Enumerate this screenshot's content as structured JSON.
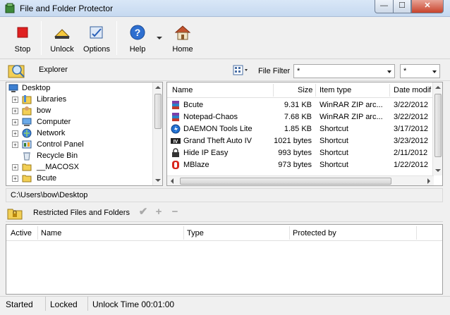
{
  "window": {
    "title": "File and Folder Protector",
    "min_glyph": "—",
    "max_glyph": "☐",
    "close_glyph": "✕"
  },
  "toolbar": {
    "stop": "Stop",
    "unlock": "Unlock",
    "options": "Options",
    "help": "Help",
    "home": "Home"
  },
  "explorer": {
    "label": "Explorer",
    "file_filter_label": "File Filter",
    "filter_value_1": "*",
    "filter_value_2": "*"
  },
  "tree": {
    "items": [
      {
        "label": "Desktop",
        "icon": "desktop-icon"
      },
      {
        "label": "Libraries",
        "icon": "libraries-icon"
      },
      {
        "label": "bow",
        "icon": "user-folder-icon"
      },
      {
        "label": "Computer",
        "icon": "computer-icon"
      },
      {
        "label": "Network",
        "icon": "network-icon"
      },
      {
        "label": "Control Panel",
        "icon": "control-panel-icon"
      },
      {
        "label": "Recycle Bin",
        "icon": "recycle-bin-icon"
      },
      {
        "label": "__MACOSX",
        "icon": "folder-icon"
      },
      {
        "label": "Bcute",
        "icon": "folder-icon"
      }
    ]
  },
  "files": {
    "headers": [
      "Name",
      "Size",
      "Item type",
      "Date modif"
    ],
    "rows": [
      {
        "name": "Bcute",
        "size": "9.31 KB",
        "type": "WinRAR ZIP arc...",
        "date": "3/22/2012",
        "icon": "winrar-icon"
      },
      {
        "name": "Notepad-Chaos",
        "size": "7.68 KB",
        "type": "WinRAR ZIP arc...",
        "date": "3/22/2012",
        "icon": "winrar-icon"
      },
      {
        "name": "DAEMON Tools Lite",
        "size": "1.85 KB",
        "type": "Shortcut",
        "date": "3/17/2012",
        "icon": "daemon-tools-icon"
      },
      {
        "name": "Grand Theft Auto IV",
        "size": "1021 bytes",
        "type": "Shortcut",
        "date": "3/23/2012",
        "icon": "gta-icon"
      },
      {
        "name": "Hide IP Easy",
        "size": "993 bytes",
        "type": "Shortcut",
        "date": "2/11/2012",
        "icon": "lock-icon"
      },
      {
        "name": "MBlaze",
        "size": "973 bytes",
        "type": "Shortcut",
        "date": "1/22/2012",
        "icon": "mblaze-icon"
      }
    ]
  },
  "path": "C:\\Users\\bow\\Desktop",
  "restricted": {
    "label": "Restricted Files and Folders",
    "check_glyph": "✔",
    "add_glyph": "+",
    "remove_glyph": "−",
    "headers": [
      "Active",
      "Name",
      "Type",
      "Protected by"
    ]
  },
  "status": {
    "state": "Started",
    "lock_state": "Locked",
    "unlock_time": "Unlock Time 00:01:00"
  },
  "colors": {
    "stop_red": "#e02020",
    "help_blue": "#2e6fd0",
    "folder_yellow": "#f2cf55"
  }
}
